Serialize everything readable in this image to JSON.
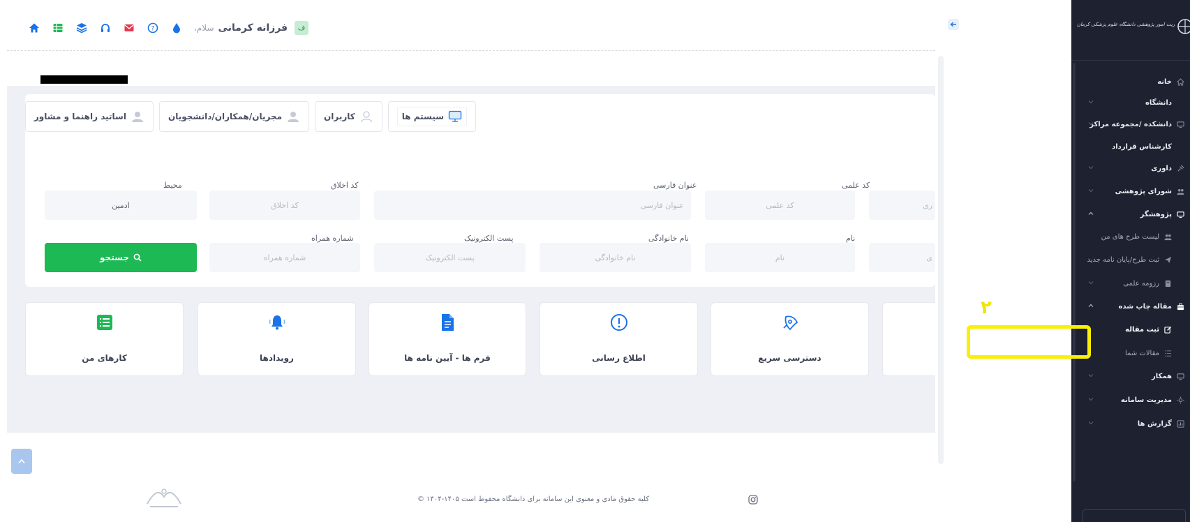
{
  "topbar": {
    "greeting": "سلام،",
    "username": "فرزانه کرمانی",
    "avatar_letter": "ف",
    "icons": [
      "home-icon",
      "table-icon",
      "layers-icon",
      "headset-icon",
      "mail-icon",
      "help-icon",
      "drop-icon"
    ],
    "colors": {
      "primary": "#1a73e8",
      "mail": "#e53950",
      "green": "#1db954"
    }
  },
  "tabs": [
    {
      "label": "سیستم ها",
      "icon": "monitor-icon",
      "active": true
    },
    {
      "label": "کاربران",
      "icon": "user-outline-icon",
      "active": false
    },
    {
      "label": "مجریان/همکاران/دانشجویان",
      "icon": "user-icon",
      "active": false
    },
    {
      "label": "اساتید راهنما و مشاور",
      "icon": "user-icon",
      "active": false
    }
  ],
  "search_form": {
    "row1": {
      "scientific_code": {
        "label": "کد علمی",
        "placeholder": "کد علمی"
      },
      "persian_title": {
        "label": "عنوان فارسی",
        "placeholder": "عنوان فارسی"
      },
      "ethics_code": {
        "label": "کد اخلاق",
        "placeholder": "کد اخلاق"
      },
      "environment": {
        "label": "محیط",
        "value": "ادمین"
      },
      "partial_left": "ری"
    },
    "row2": {
      "first_name": {
        "label": "نام",
        "placeholder": "نام"
      },
      "last_name": {
        "label": "نام خانوادگی",
        "placeholder": "نام خانوادگی"
      },
      "email": {
        "label": "پست الکترونیک",
        "placeholder": "پست الکترونیک"
      },
      "mobile": {
        "label": "شماره همراه",
        "placeholder": "شماره همراه"
      },
      "partial_left": "ی"
    },
    "search_button": "جستجو"
  },
  "quick_cards": [
    {
      "label": "کارهای من",
      "icon": "list-icon"
    },
    {
      "label": "رویدادها",
      "icon": "bell-icon"
    },
    {
      "label": "فرم ها - آیین نامه ها",
      "icon": "document-icon"
    },
    {
      "label": "اطلاع رسانی",
      "icon": "alert-icon"
    },
    {
      "label": "دسترسی سریع",
      "icon": "rocket-icon"
    }
  ],
  "footer": {
    "text": "© ۱۴۰۴-۱۴۰۵ کلیه حقوق مادی و معنوی این سامانه برای دانشگاه محفوظ است"
  },
  "sidebar": {
    "title": "پژوهشیار، سامانه مدیریت امور پژوهشی دانشگاه علوم پزشکی کرمان",
    "items": [
      {
        "label": "خانه",
        "icon": "home-icon",
        "sub": false,
        "chevron": false
      },
      {
        "label": "دانشگاه",
        "icon": "",
        "sub": false,
        "chevron": true
      },
      {
        "label": "دانشکده /مجموعه مراکز",
        "icon": "monitor-icon",
        "sub": false,
        "chevron": true
      },
      {
        "label": "کارشناس قرارداد",
        "icon": "",
        "sub": false,
        "chevron": false
      },
      {
        "label": "داوری",
        "icon": "gavel-icon",
        "sub": false,
        "chevron": true
      },
      {
        "label": "شورای پژوهشی",
        "icon": "group-icon",
        "sub": false,
        "chevron": true
      },
      {
        "label": "پژوهشگر",
        "icon": "monitor-icon",
        "sub": false,
        "chevron": true
      },
      {
        "label": "لیست طرح های من",
        "icon": "group-icon",
        "sub": true,
        "chevron": false
      },
      {
        "label": "ثبت طرح/پایان نامه جدید",
        "icon": "send-icon",
        "sub": true,
        "chevron": false
      },
      {
        "label": "رزومه علمی",
        "icon": "book-icon",
        "sub": true,
        "chevron": true
      },
      {
        "label": "مقاله چاپ شده",
        "icon": "briefcase-icon",
        "sub": false,
        "chevron": true
      },
      {
        "label": "ثبت مقاله",
        "icon": "edit-icon",
        "sub": true,
        "chevron": false
      },
      {
        "label": "مقالات شما",
        "icon": "list-icon",
        "sub": true,
        "chevron": false
      },
      {
        "label": "همکار",
        "icon": "monitor-icon",
        "sub": false,
        "chevron": true
      },
      {
        "label": "مدیریت سامانه",
        "icon": "settings-icon",
        "sub": false,
        "chevron": true
      },
      {
        "label": "گزارش ها",
        "icon": "chart-icon",
        "sub": false,
        "chevron": true
      }
    ]
  },
  "annotation": {
    "number": "۲"
  }
}
